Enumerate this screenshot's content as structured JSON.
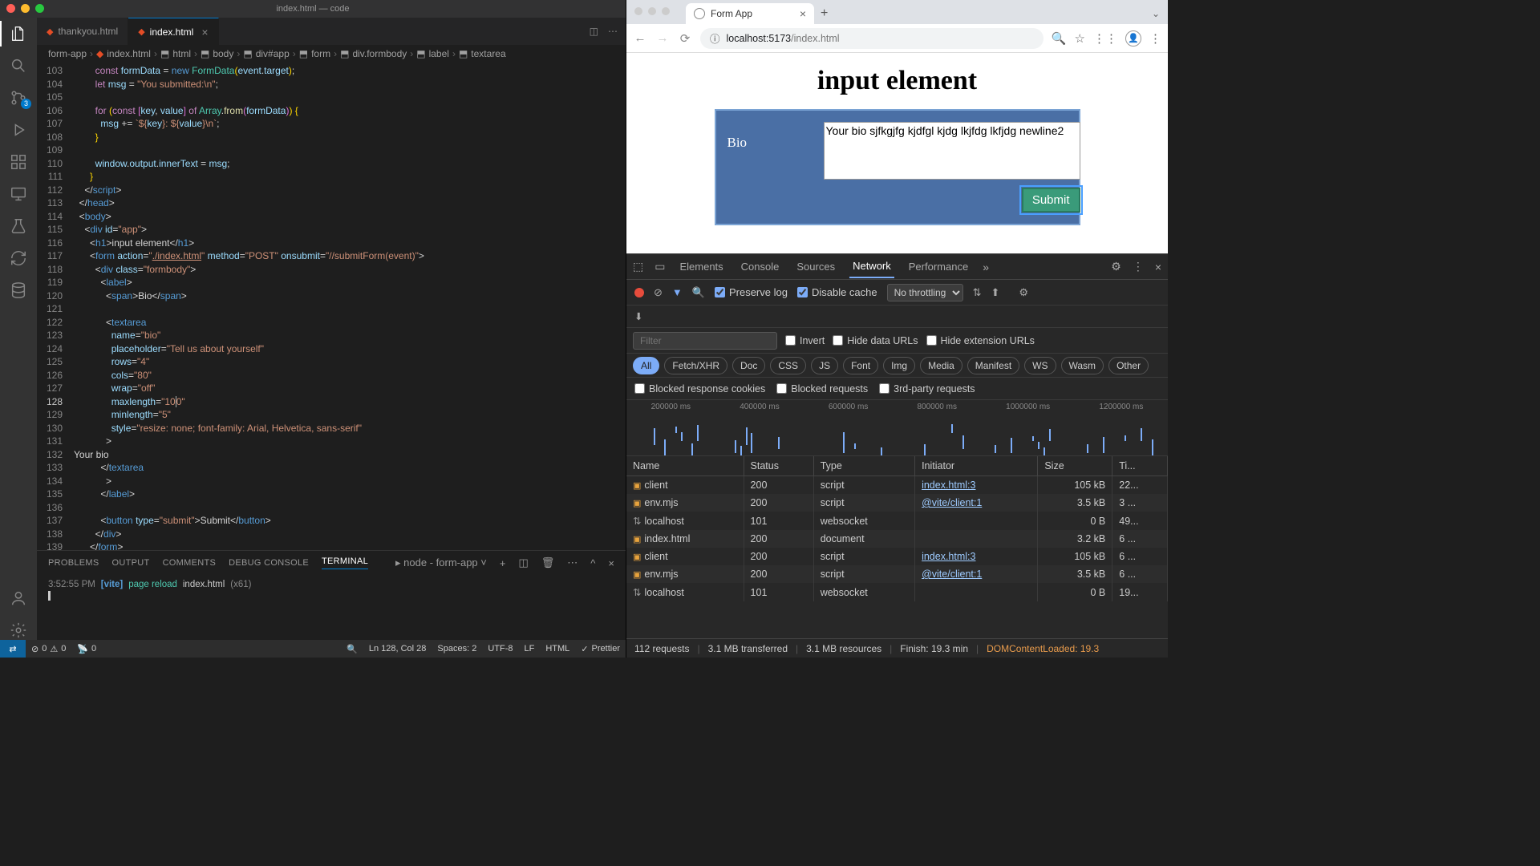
{
  "vscode": {
    "title": "index.html — code",
    "tabs": [
      {
        "label": "thankyou.html",
        "active": false
      },
      {
        "label": "index.html",
        "active": true
      }
    ],
    "breadcrumb": [
      "form-app",
      "index.html",
      "html",
      "body",
      "div#app",
      "form",
      "div.formbody",
      "label",
      "textarea"
    ],
    "gutter_start": 103,
    "active_line": 128,
    "code_lines": [
      "        <span class='m'>const</span> <span class='v'>formData</span> <span class='p'>=</span> <span class='k'>new</span> <span class='t'>FormData</span><span class='br'>(</span><span class='v'>event</span><span class='p'>.</span><span class='v'>target</span><span class='br'>)</span><span class='p'>;</span>",
      "        <span class='m'>let</span> <span class='v'>msg</span> <span class='p'>=</span> <span class='s'>\"You submitted:\\n\"</span><span class='p'>;</span>",
      "",
      "        <span class='m'>for</span> <span class='br'>(</span><span class='m'>const</span> <span class='br2'>[</span><span class='v'>key</span><span class='p'>,</span> <span class='v'>value</span><span class='br2'>]</span> <span class='m'>of</span> <span class='t'>Array</span><span class='p'>.</span><span class='f'>from</span><span class='br2'>(</span><span class='v'>formData</span><span class='br2'>)</span><span class='br'>)</span> <span class='br'>{</span>",
      "          <span class='v'>msg</span> <span class='p'>+=</span> <span class='s'>`${</span><span class='v'>key</span><span class='s'>}: ${</span><span class='v'>value</span><span class='s'>}\\n`</span><span class='p'>;</span>",
      "        <span class='br'>}</span>",
      "",
      "        <span class='v'>window</span><span class='p'>.</span><span class='v'>output</span><span class='p'>.</span><span class='v'>innerText</span> <span class='p'>=</span> <span class='v'>msg</span><span class='p'>;</span>",
      "      <span class='br'>}</span>",
      "    <span class='p'>&lt;/</span><span class='k'>script</span><span class='p'>&gt;</span>",
      "  <span class='p'>&lt;/</span><span class='k'>head</span><span class='p'>&gt;</span>",
      "  <span class='p'>&lt;</span><span class='k'>body</span><span class='p'>&gt;</span>",
      "    <span class='p'>&lt;</span><span class='k'>div</span> <span class='a'>id</span><span class='p'>=</span><span class='s'>\"app\"</span><span class='p'>&gt;</span>",
      "      <span class='p'>&lt;</span><span class='k'>h1</span><span class='p'>&gt;</span>input element<span class='p'>&lt;/</span><span class='k'>h1</span><span class='p'>&gt;</span>",
      "      <span class='p'>&lt;</span><span class='k'>form</span> <span class='a'>action</span><span class='p'>=</span><span class='s'>\"<u>./index.html</u>\"</span> <span class='a'>method</span><span class='p'>=</span><span class='s'>\"POST\"</span> <span class='a'>onsubmit</span><span class='p'>=</span><span class='s'>\"//submitForm(event)\"</span><span class='p'>&gt;</span>",
      "        <span class='p'>&lt;</span><span class='k'>div</span> <span class='a'>class</span><span class='p'>=</span><span class='s'>\"formbody\"</span><span class='p'>&gt;</span>",
      "          <span class='p'>&lt;</span><span class='k'>label</span><span class='p'>&gt;</span>",
      "            <span class='p'>&lt;</span><span class='k'>span</span><span class='p'>&gt;</span>Bio<span class='p'>&lt;/</span><span class='k'>span</span><span class='p'>&gt;</span>",
      "",
      "            <span class='p'>&lt;</span><span class='k'>textarea</span>",
      "              <span class='a'>name</span><span class='p'>=</span><span class='s'>\"bio\"</span>",
      "              <span class='a'>placeholder</span><span class='p'>=</span><span class='s'>\"Tell us about yourself\"</span>",
      "              <span class='a'>rows</span><span class='p'>=</span><span class='s'>\"4\"</span>",
      "              <span class='a'>cols</span><span class='p'>=</span><span class='s'>\"80\"</span>",
      "              <span class='a'>wrap</span><span class='p'>=</span><span class='s'>\"off\"</span>",
      "              <span class='a'>maxlength</span><span class='p'>=</span><span class='s'>\"10<span style='border-left:1px solid #aeafad'>0</span>\"</span>",
      "              <span class='a'>minlength</span><span class='p'>=</span><span class='s'>\"5\"</span>",
      "              <span class='a'>style</span><span class='p'>=</span><span class='s'>\"resize: none; font-family: Arial, Helvetica, sans-serif\"</span>",
      "            <span class='p'>&gt;</span>",
      "Your bio",
      "          <span class='p'>&lt;/</span><span class='k'>textarea</span>",
      "            <span class='p'>&gt;</span>",
      "          <span class='p'>&lt;/</span><span class='k'>label</span><span class='p'>&gt;</span>",
      "",
      "          <span class='p'>&lt;</span><span class='k'>button</span> <span class='a'>type</span><span class='p'>=</span><span class='s'>\"submit\"</span><span class='p'>&gt;</span>Submit<span class='p'>&lt;/</span><span class='k'>button</span><span class='p'>&gt;</span>",
      "        <span class='p'>&lt;/</span><span class='k'>div</span><span class='p'>&gt;</span>",
      "      <span class='p'>&lt;/</span><span class='k'>form</span><span class='p'>&gt;</span>",
      ""
    ],
    "panel": {
      "tabs": [
        "PROBLEMS",
        "OUTPUT",
        "COMMENTS",
        "DEBUG CONSOLE",
        "TERMINAL"
      ],
      "active_tab": "TERMINAL",
      "dropdown": "node - form-app",
      "line_time": "3:52:55 PM",
      "line_vite": "[vite]",
      "line_text": "page reload",
      "line_file": "index.html",
      "line_count": "(x61)"
    },
    "statusbar": {
      "errors": "0",
      "warnings": "0",
      "ports": "0",
      "cursor": "Ln 128, Col 28",
      "spaces": "Spaces: 2",
      "encoding": "UTF-8",
      "eol": "LF",
      "lang": "HTML",
      "prettier": "Prettier"
    },
    "scm_badge": "3"
  },
  "browser": {
    "tab_title": "Form App",
    "url_host": "localhost:5173",
    "url_path": "/index.html",
    "page": {
      "heading": "input element",
      "label": "Bio",
      "textarea_value": "Your bio sjfkgjfg kjdfgl kjdg lkjfdg lkfjdg newline2",
      "textarea_placeholder": "Tell us about yourself",
      "submit": "Submit"
    }
  },
  "devtools": {
    "tabs": [
      "Elements",
      "Console",
      "Sources",
      "Network",
      "Performance"
    ],
    "active_tab": "Network",
    "preserve_log": "Preserve log",
    "disable_cache": "Disable cache",
    "throttling": "No throttling",
    "filter_placeholder": "Filter",
    "invert": "Invert",
    "hide_data": "Hide data URLs",
    "hide_ext": "Hide extension URLs",
    "types": [
      "All",
      "Fetch/XHR",
      "Doc",
      "CSS",
      "JS",
      "Font",
      "Img",
      "Media",
      "Manifest",
      "WS",
      "Wasm",
      "Other"
    ],
    "active_type": "All",
    "blocked_cookies": "Blocked response cookies",
    "blocked_reqs": "Blocked requests",
    "third_party": "3rd-party requests",
    "timeline_ticks": [
      "200000 ms",
      "400000 ms",
      "600000 ms",
      "800000 ms",
      "1000000 ms",
      "1200000 ms"
    ],
    "columns": [
      "Name",
      "Status",
      "Type",
      "Initiator",
      "Size",
      "Ti..."
    ],
    "rows": [
      {
        "icon": "js",
        "name": "client",
        "status": "200",
        "type": "script",
        "initiator": "index.html:3",
        "size": "105 kB",
        "time": "22..."
      },
      {
        "icon": "js",
        "name": "env.mjs",
        "status": "200",
        "type": "script",
        "initiator": "@vite/client:1",
        "size": "3.5 kB",
        "time": "3 ..."
      },
      {
        "icon": "ws",
        "name": "localhost",
        "status": "101",
        "type": "websocket",
        "initiator": "",
        "size": "0 B",
        "time": "49..."
      },
      {
        "icon": "doc",
        "name": "index.html",
        "status": "200",
        "type": "document",
        "initiator": "",
        "size": "3.2 kB",
        "time": "6 ..."
      },
      {
        "icon": "js",
        "name": "client",
        "status": "200",
        "type": "script",
        "initiator": "index.html:3",
        "size": "105 kB",
        "time": "6 ..."
      },
      {
        "icon": "js",
        "name": "env.mjs",
        "status": "200",
        "type": "script",
        "initiator": "@vite/client:1",
        "size": "3.5 kB",
        "time": "6 ..."
      },
      {
        "icon": "ws",
        "name": "localhost",
        "status": "101",
        "type": "websocket",
        "initiator": "",
        "size": "0 B",
        "time": "19..."
      }
    ],
    "status": {
      "requests": "112 requests",
      "transferred": "3.1 MB transferred",
      "resources": "3.1 MB resources",
      "finish": "Finish: 19.3 min",
      "dom": "DOMContentLoaded: 19.3"
    }
  }
}
